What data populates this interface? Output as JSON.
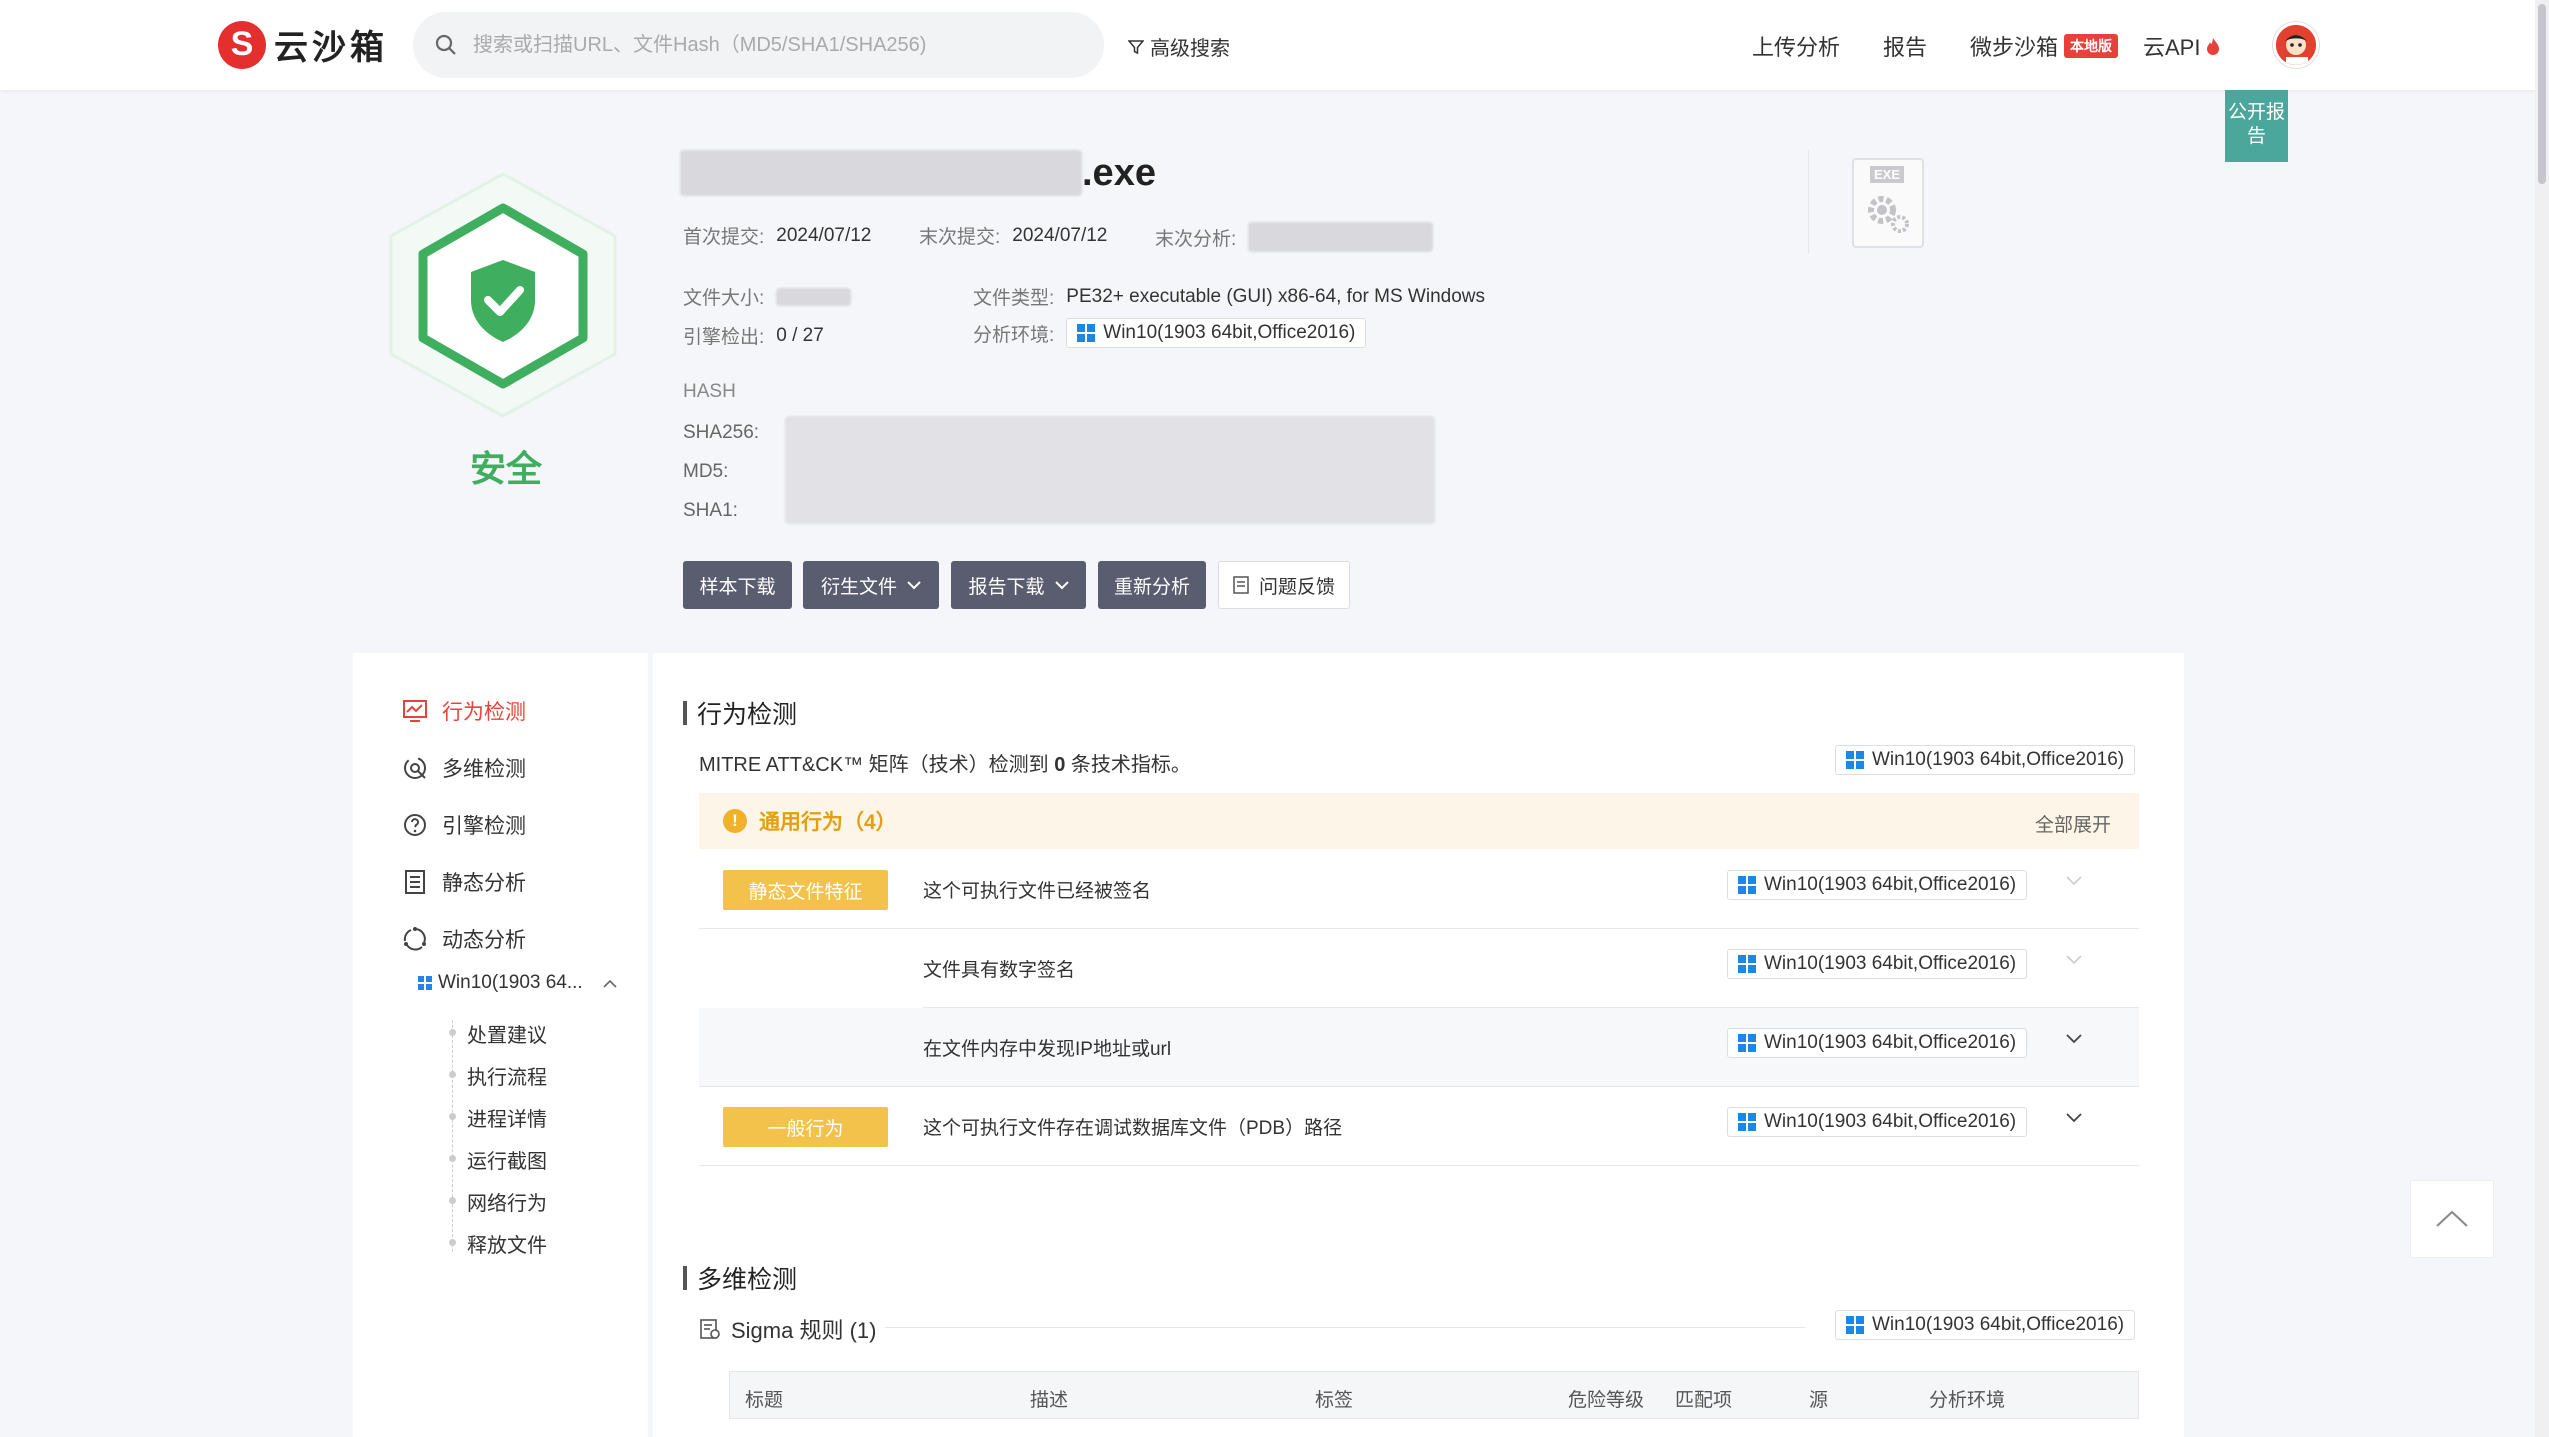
{
  "header": {
    "logo_text": "云沙箱",
    "search_placeholder": "搜索或扫描URL、文件Hash（MD5/SHA1/SHA256)",
    "advanced_search": "高级搜索",
    "nav": [
      {
        "label": "上传分析"
      },
      {
        "label": "报告"
      },
      {
        "label": "微步沙箱",
        "badge": "本地版"
      },
      {
        "label": "云API"
      }
    ]
  },
  "public_report": "公开报告",
  "summary": {
    "file_ext": ".exe",
    "verdict": "安全",
    "first_submit_label": "首次提交:",
    "first_submit": "2024/07/12",
    "last_submit_label": "末次提交:",
    "last_submit": "2024/07/12",
    "last_analysis_label": "末次分析:",
    "file_size_label": "文件大小:",
    "engine_label": "引擎检出:",
    "engine_value": "0 / 27",
    "file_type_label": "文件类型:",
    "file_type": "PE32+ executable (GUI) x86-64, for MS Windows",
    "env_label": "分析环境:",
    "env": "Win10(1903 64bit,Office2016)",
    "hash_header": "HASH",
    "sha256_label": "SHA256:",
    "md5_label": "MD5:",
    "sha1_label": "SHA1:",
    "exe_tag": "EXE"
  },
  "actions": {
    "sample_download": "样本下载",
    "derived_files": "衍生文件",
    "report_download": "报告下载",
    "reanalyze": "重新分析",
    "feedback": "问题反馈"
  },
  "sidebar": {
    "items": [
      {
        "label": "行为检测",
        "icon": "chart-monitor-icon"
      },
      {
        "label": "多维检测",
        "icon": "radar-icon"
      },
      {
        "label": "引擎检测",
        "icon": "question-circle-icon"
      },
      {
        "label": "静态分析",
        "icon": "list-doc-icon"
      },
      {
        "label": "动态分析",
        "icon": "cycle-icon"
      }
    ],
    "sub_env": "Win10(1903 64...",
    "tree": [
      "处置建议",
      "执行流程",
      "进程详情",
      "运行截图",
      "网络行为",
      "释放文件"
    ]
  },
  "behavior": {
    "title": "行为检测",
    "mitre_prefix": "MITRE ATT&CK™ 矩阵（技术）检测到",
    "mitre_count": "0",
    "mitre_suffix": "条技术指标。",
    "env": "Win10(1903 64bit,Office2016)",
    "general_title": "通用行为（4）",
    "expand_all": "全部展开",
    "rows": [
      {
        "category": "静态文件特征",
        "text": "这个可执行文件已经被签名",
        "env": "Win10(1903 64bit,Office2016)"
      },
      {
        "category": "",
        "text": "文件具有数字签名",
        "env": "Win10(1903 64bit,Office2016)"
      },
      {
        "category": "",
        "text": "在文件内存中发现IP地址或url",
        "env": "Win10(1903 64bit,Office2016)"
      },
      {
        "category": "一般行为",
        "text": "这个可执行文件存在调试数据库文件（PDB）路径",
        "env": "Win10(1903 64bit,Office2016)"
      }
    ]
  },
  "multi": {
    "title": "多维检测",
    "sigma_title": "Sigma 规则 (1)",
    "env": "Win10(1903 64bit,Office2016)",
    "columns": [
      "标题",
      "描述",
      "标签",
      "危险等级",
      "匹配项",
      "源",
      "分析环境"
    ]
  }
}
